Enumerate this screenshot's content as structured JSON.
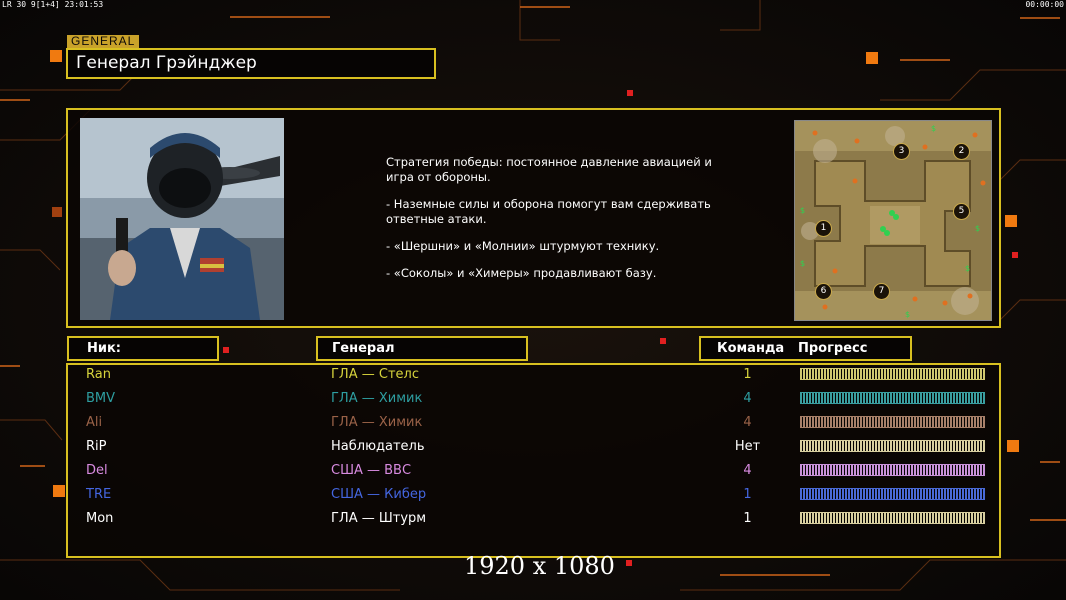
{
  "hud": {
    "left": "LR 30 9[1+4] 23:01:53",
    "right": "00:00:00"
  },
  "tag": "GENERAL",
  "general_name": "Генерал Грэйнджер",
  "description": [
    "Стратегия победы: постоянное давление авиацией и игра от обороны.",
    "- Наземные силы и оборона помогут вам сдерживать ответные атаки.",
    "- «Шершни» и «Молнии» штурмуют технику.",
    "- «Соколы» и «Химеры» продавливают базу."
  ],
  "map_markers": [
    "1",
    "2",
    "3",
    "5",
    "6",
    "7"
  ],
  "headers": {
    "nick": "Ник:",
    "general": "Генерал",
    "team": "Команда",
    "progress": "Прогресс"
  },
  "players": [
    {
      "nick": "Ran",
      "general": "ГЛА — Стелс",
      "team": "1",
      "color": "#d7d43c"
    },
    {
      "nick": "BMV",
      "general": "ГЛА — Химик",
      "team": "4",
      "color": "#2e9ea1"
    },
    {
      "nick": "Ali",
      "general": "ГЛА — Химик",
      "team": "4",
      "color": "#9a6248"
    },
    {
      "nick": "RiP",
      "general": "Наблюдатель",
      "team": "Нет",
      "color": "#ffffff"
    },
    {
      "nick": "Del",
      "general": "США — ВВС",
      "team": "4",
      "color": "#d88be0"
    },
    {
      "nick": "TRE",
      "general": "США — Кибер",
      "team": "1",
      "color": "#4466e0"
    },
    {
      "nick": "Mon",
      "general": "ГЛА — Штурм",
      "team": "1",
      "color": "#ffffff"
    }
  ],
  "progress_bars": [
    {
      "color": "#d0c870",
      "progress": 1.0
    },
    {
      "color": "#3a9ea0",
      "progress": 1.0
    },
    {
      "color": "#a8806a",
      "progress": 1.0
    },
    {
      "color": "#d8cfa0",
      "progress": 1.0
    },
    {
      "color": "#c890d8",
      "progress": 1.0
    },
    {
      "color": "#4a6ad8",
      "progress": 1.0
    },
    {
      "color": "#d8cfa0",
      "progress": 1.0
    }
  ],
  "resolution_label": "1920 x 1080"
}
